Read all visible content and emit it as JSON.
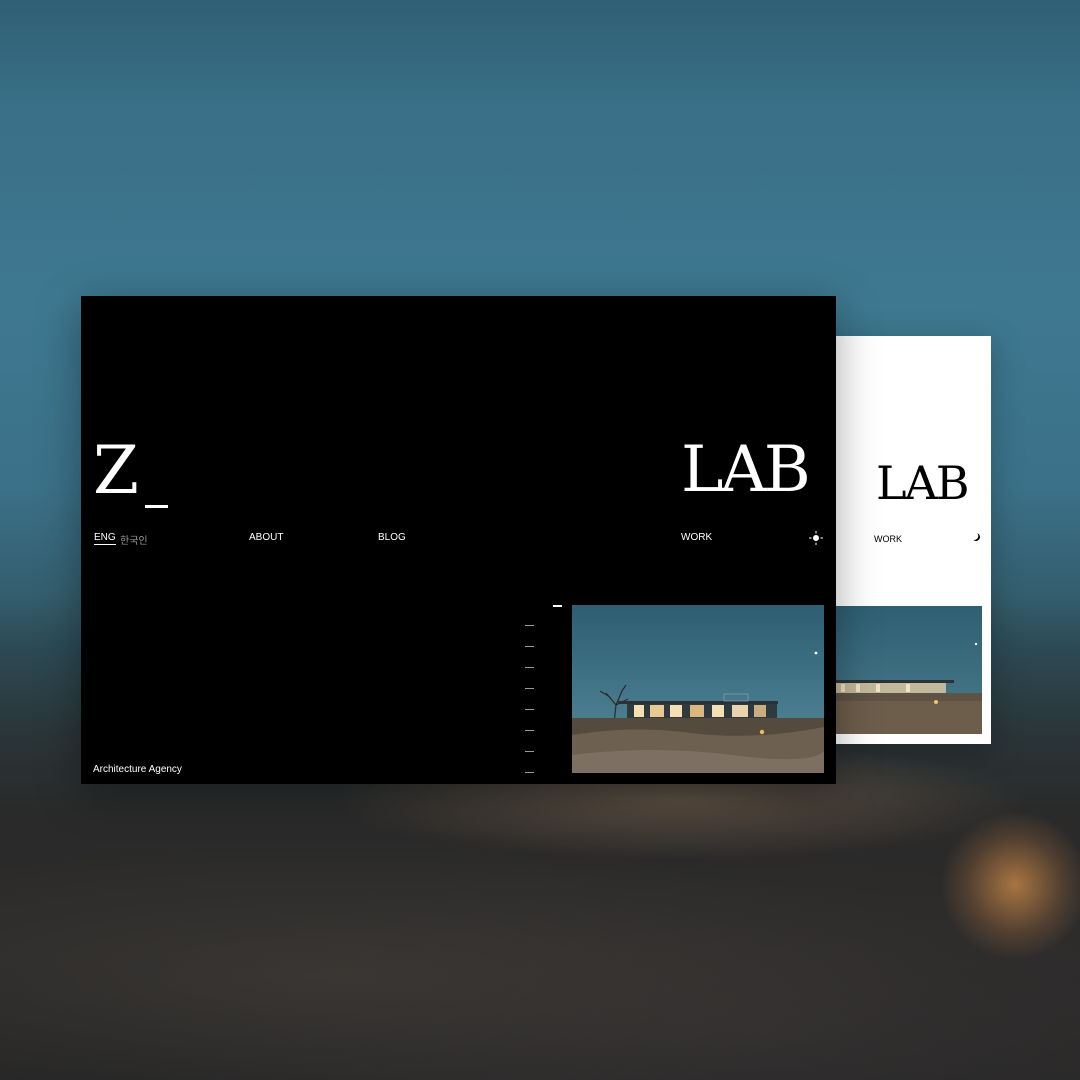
{
  "dark": {
    "logo_left": "Z",
    "logo_right": "LAB",
    "nav": {
      "lang_eng": "ENG",
      "lang_kor": "한국인",
      "about": "ABOUT",
      "blog": "BLOG",
      "work": "WORK"
    },
    "tagline": "Architecture Agency",
    "theme_icon": "sun-icon"
  },
  "light": {
    "logo": "LAB",
    "work": "WORK",
    "theme_icon": "moon-icon"
  },
  "colors": {
    "dark_bg": "#000000",
    "light_bg": "#ffffff",
    "inactive_text": "#9a9a9a"
  }
}
